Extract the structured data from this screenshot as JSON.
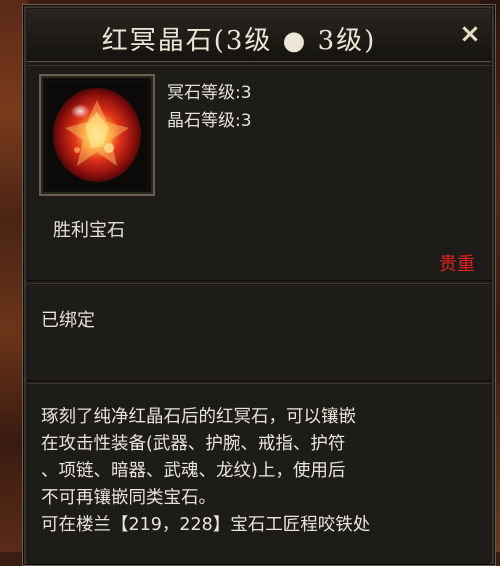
{
  "tooltip": {
    "title": "红冥晶石(3级 ● 3级)",
    "close_glyph": "×",
    "stats": [
      "冥石等级:3",
      "晶石等级:3"
    ],
    "sub_name": "胜利宝石",
    "quality": "贵重",
    "bind_status": "已绑定",
    "description_lines": [
      "琢刻了纯净红晶石后的红冥石，可以镶嵌",
      "在攻击性装备(武器、护腕、戒指、护符",
      "、项链、暗器、武魂、龙纹)上，使用后",
      "不可再镶嵌同类宝石。",
      "可在楼兰【219，228】宝石工匠程咬铁处"
    ],
    "icon": "red-gem-icon",
    "colors": {
      "quality": "#e0211b",
      "text": "#e4e0d6",
      "panel": "#1c1a17"
    }
  }
}
